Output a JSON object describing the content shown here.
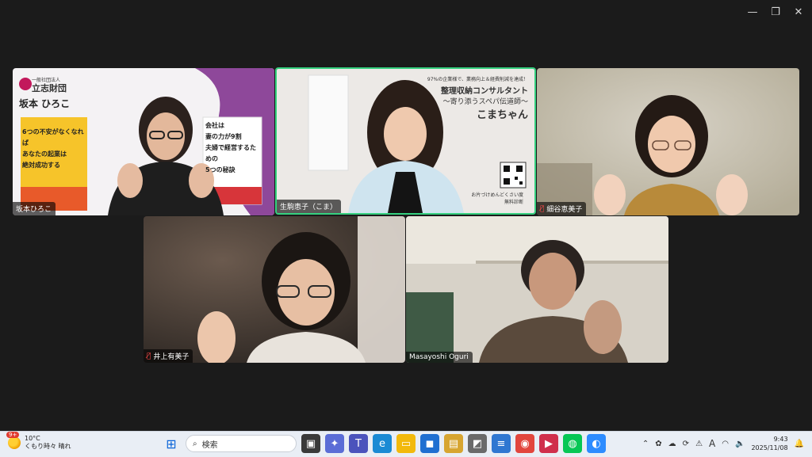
{
  "window": {
    "controls": {
      "minimize": "—",
      "restore": "❐",
      "close": "✕"
    }
  },
  "tiles": [
    {
      "id": "tile1",
      "name": "坂本ひろこ",
      "muted": false,
      "org": "一般社団法人",
      "org2": "立志財団",
      "person": "坂本 ひろこ",
      "book1": [
        "6つの不安がなくなれば",
        "あなたの起業は",
        "絶対成功する"
      ],
      "book2": [
        "会社は",
        "妻の力が9割",
        "夫婦で経営するための",
        "5つの秘訣"
      ]
    },
    {
      "id": "tile2",
      "name": "生駒恵子（こま）",
      "muted": false,
      "speaking": true,
      "bg_lines": [
        "97%の企業様で、業務向上＆経費削減を達成！",
        "整理収納コンサルタント",
        "〜寄り添うスペパ伝道師〜",
        "こまちゃん"
      ],
      "bg_footer": [
        "お片づけめんどくさい度",
        "無料診断"
      ]
    },
    {
      "id": "tile3",
      "name": "細谷恵美子",
      "muted": true
    },
    {
      "id": "tile4",
      "name": "井上有美子",
      "muted": true
    },
    {
      "id": "tile5",
      "name": "Masayoshi Oguri",
      "muted": false
    }
  ],
  "taskbar": {
    "weather_temp": "10°C",
    "weather_desc": "くもり時々 晴れ",
    "weather_badge": "9+",
    "search_placeholder": "検索",
    "tray_ime": "A",
    "time": "9:43",
    "date": "2025/11/08"
  },
  "colors": {
    "speaking_border": "#35d07f",
    "mute": "#ff4a4a",
    "taskbar": "#e9eef5"
  }
}
